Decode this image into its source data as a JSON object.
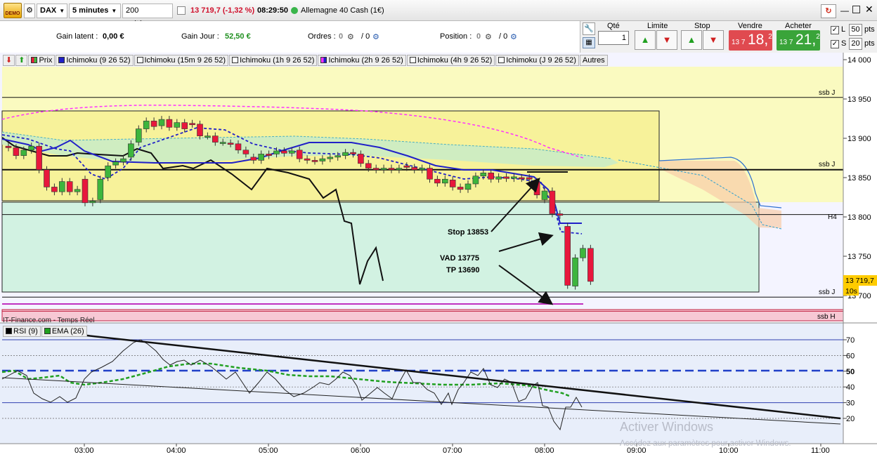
{
  "toolbar": {
    "logo_text": "DEMO",
    "instrument": "DAX",
    "timeframe": "5 minutes",
    "units": "200 unités",
    "price_change": "13 719,7 (-1,32 %)",
    "time": "08:29:50",
    "market_name": "Allemagne 40 Cash (1€)"
  },
  "infobar": {
    "gain_latent_label": "Gain latent :",
    "gain_latent_value": "0,00 €",
    "gain_jour_label": "Gain Jour :",
    "gain_jour_value": "52,50 €",
    "ordres_label": "Ordres :",
    "ordres_value": "0",
    "ordres_sep": "/ 0",
    "position_label": "Position :",
    "position_value": "0",
    "position_sep": "/ 0"
  },
  "order_panel": {
    "qty_label": "Qté",
    "qty_value": "1",
    "limite_label": "Limite",
    "stop_label": "Stop",
    "vendre_label": "Vendre",
    "vendre_small": "13 7",
    "vendre_big": "18,",
    "vendre_sup": "2",
    "acheter_label": "Acheter",
    "acheter_small": "13 7",
    "acheter_big": "21,",
    "acheter_sup": "2",
    "l_label": "L",
    "l_value": "50",
    "s_label": "S",
    "s_value": "20",
    "pts": "pts"
  },
  "legend": {
    "price": "Prix",
    "items": [
      "Ichimoku (9 26 52)",
      "Ichimoku (15m 9 26 52)",
      "Ichimoku (1h 9 26 52)",
      "Ichimoku (2h 9 26 52)",
      "Ichimoku (4h 9 26 52)",
      "Ichimoku (J 9 26 52)"
    ],
    "autres": "Autres"
  },
  "price_axis": {
    "ticks": [
      "14 000",
      "13 950",
      "13 900",
      "13 850",
      "13 800",
      "13 750",
      "13 700"
    ],
    "current_price": "13 719,7",
    "countdown": "10s"
  },
  "annotations": {
    "ssb_labels": [
      "ssb J",
      "ssb J",
      "H4",
      "ssb J",
      "ssb H"
    ],
    "stop": "Stop 13853",
    "vad": "VAD 13775",
    "tp": "TP 13690",
    "source": "IT-Finance.com - Temps Réel"
  },
  "rsi": {
    "rsi_label": "RSI (9)",
    "ema_label": "EMA (26)",
    "ticks": [
      "70",
      "60",
      "50",
      "40",
      "30",
      "20"
    ]
  },
  "time_axis": [
    "03:00",
    "04:00",
    "05:00",
    "06:00",
    "07:00",
    "08:00",
    "09:00",
    "10:00",
    "11:00"
  ],
  "watermark": {
    "title": "Activer Windows",
    "subtitle": "Accédez aux paramètres pour activer Windows."
  },
  "colors": {
    "bull": "#3db53d",
    "bear": "#e8173c",
    "tenkan": "#000000",
    "kijun": "#2020c8",
    "magenta": "#ff30ff",
    "cloud": "#c8ecc8",
    "yellow_zone": "#fafac0",
    "green_zone": "#d2f2e2",
    "red_band": "#f7c8d4"
  },
  "chart_data": {
    "type": "candlestick",
    "price_range": [
      13690,
      14000
    ],
    "candles": [
      {
        "t": "02:25",
        "o": 13890,
        "c": 13888
      },
      {
        "t": "02:30",
        "o": 13888,
        "c": 13878
      },
      {
        "t": "02:35",
        "o": 13878,
        "c": 13885
      },
      {
        "t": "02:40",
        "o": 13885,
        "c": 13890
      },
      {
        "t": "02:45",
        "o": 13890,
        "c": 13860
      },
      {
        "t": "02:50",
        "o": 13860,
        "c": 13838
      },
      {
        "t": "02:55",
        "o": 13838,
        "c": 13832
      },
      {
        "t": "03:00",
        "o": 13832,
        "c": 13845
      },
      {
        "t": "03:05",
        "o": 13845,
        "c": 13832
      },
      {
        "t": "03:10",
        "o": 13832,
        "c": 13835
      },
      {
        "t": "03:15",
        "o": 13848,
        "c": 13818
      },
      {
        "t": "03:20",
        "o": 13818,
        "c": 13820
      },
      {
        "t": "03:25",
        "o": 13822,
        "c": 13848
      },
      {
        "t": "03:30",
        "o": 13850,
        "c": 13865
      },
      {
        "t": "03:35",
        "o": 13866,
        "c": 13870
      },
      {
        "t": "03:40",
        "o": 13870,
        "c": 13874
      },
      {
        "t": "03:45",
        "o": 13876,
        "c": 13893
      },
      {
        "t": "03:50",
        "o": 13895,
        "c": 13912
      },
      {
        "t": "03:55",
        "o": 13912,
        "c": 13922
      },
      {
        "t": "04:00",
        "o": 13922,
        "c": 13915
      },
      {
        "t": "04:05",
        "o": 13916,
        "c": 13924
      },
      {
        "t": "04:10",
        "o": 13924,
        "c": 13914
      },
      {
        "t": "04:15",
        "o": 13914,
        "c": 13920
      },
      {
        "t": "04:20",
        "o": 13920,
        "c": 13912
      },
      {
        "t": "04:25",
        "o": 13919,
        "c": 13918
      },
      {
        "t": "04:30",
        "o": 13918,
        "c": 13903
      },
      {
        "t": "04:35",
        "o": 13903,
        "c": 13903
      },
      {
        "t": "04:40",
        "o": 13903,
        "c": 13895
      },
      {
        "t": "04:45",
        "o": 13895,
        "c": 13895
      },
      {
        "t": "04:50",
        "o": 13894,
        "c": 13893
      },
      {
        "t": "04:55",
        "o": 13893,
        "c": 13885
      },
      {
        "t": "05:00",
        "o": 13885,
        "c": 13880
      },
      {
        "t": "05:05",
        "o": 13876,
        "c": 13872
      },
      {
        "t": "05:10",
        "o": 13872,
        "c": 13880
      },
      {
        "t": "05:15",
        "o": 13880,
        "c": 13878
      },
      {
        "t": "05:20",
        "o": 13880,
        "c": 13884
      },
      {
        "t": "05:25",
        "o": 13884,
        "c": 13881
      },
      {
        "t": "05:30",
        "o": 13881,
        "c": 13884
      },
      {
        "t": "05:35",
        "o": 13885,
        "c": 13874
      },
      {
        "t": "05:40",
        "o": 13874,
        "c": 13872
      },
      {
        "t": "05:45",
        "o": 13872,
        "c": 13871
      },
      {
        "t": "05:50",
        "o": 13871,
        "c": 13874
      },
      {
        "t": "05:55",
        "o": 13874,
        "c": 13876
      },
      {
        "t": "06:00",
        "o": 13876,
        "c": 13878
      },
      {
        "t": "06:05",
        "o": 13878,
        "c": 13882
      },
      {
        "t": "06:10",
        "o": 13882,
        "c": 13880
      },
      {
        "t": "06:15",
        "o": 13880,
        "c": 13868
      },
      {
        "t": "06:20",
        "o": 13868,
        "c": 13862
      },
      {
        "t": "06:25",
        "o": 13862,
        "c": 13860
      },
      {
        "t": "06:30",
        "o": 13860,
        "c": 13862
      },
      {
        "t": "06:35",
        "o": 13862,
        "c": 13860
      },
      {
        "t": "06:40",
        "o": 13860,
        "c": 13862
      },
      {
        "t": "06:45",
        "o": 13865,
        "c": 13863
      },
      {
        "t": "06:50",
        "o": 13863,
        "c": 13860
      },
      {
        "t": "06:55",
        "o": 13860,
        "c": 13862
      },
      {
        "t": "07:00",
        "o": 13862,
        "c": 13848
      },
      {
        "t": "07:05",
        "o": 13848,
        "c": 13843
      },
      {
        "t": "07:10",
        "o": 13843,
        "c": 13848
      },
      {
        "t": "07:15",
        "o": 13847,
        "c": 13838
      },
      {
        "t": "07:20",
        "o": 13838,
        "c": 13835
      },
      {
        "t": "07:25",
        "o": 13835,
        "c": 13842
      },
      {
        "t": "07:30",
        "o": 13842,
        "c": 13852
      },
      {
        "t": "07:35",
        "o": 13852,
        "c": 13856
      },
      {
        "t": "07:40",
        "o": 13856,
        "c": 13848
      },
      {
        "t": "07:45",
        "o": 13848,
        "c": 13851
      },
      {
        "t": "07:50",
        "o": 13851,
        "c": 13849
      },
      {
        "t": "07:55",
        "o": 13849,
        "c": 13851
      },
      {
        "t": "08:00",
        "o": 13850,
        "c": 13849
      },
      {
        "t": "08:05",
        "o": 13850,
        "c": 13848
      },
      {
        "t": "08:10",
        "o": 13845,
        "c": 13828
      },
      {
        "t": "08:15",
        "o": 13822,
        "c": 13833
      },
      {
        "t": "08:20",
        "o": 13833,
        "c": 13804
      },
      {
        "t": "08:25",
        "o": 13804,
        "c": 13802
      },
      {
        "t": "08:30",
        "o": 13788,
        "c": 13713
      },
      {
        "t": "08:35",
        "o": 13712,
        "c": 13748
      },
      {
        "t": "08:40",
        "o": 13748,
        "c": 13760
      },
      {
        "t": "08:45",
        "o": 13760,
        "c": 13718
      }
    ],
    "levels": [
      {
        "label": "ssb J",
        "price": 13952
      },
      {
        "label": "ssb J",
        "price": 13860
      },
      {
        "label": "H4",
        "price": 13803
      },
      {
        "label": "ssb J",
        "price": 13698
      },
      {
        "label": "ssb H",
        "price": 13680
      }
    ],
    "rsi_range": [
      10,
      80
    ],
    "rsi_levels": [
      70,
      60,
      50,
      40,
      30,
      20
    ]
  }
}
